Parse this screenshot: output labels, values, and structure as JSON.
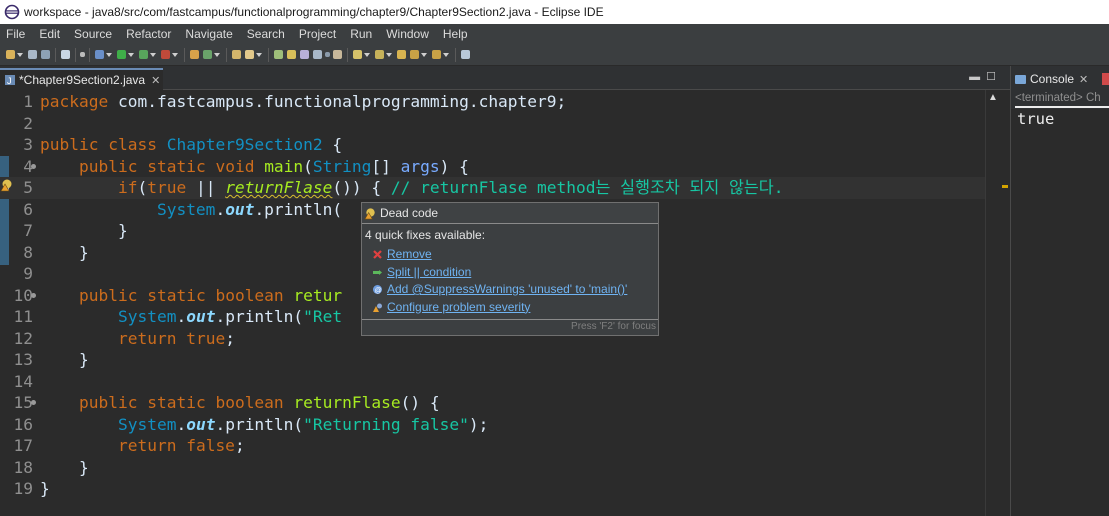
{
  "window": {
    "title": "workspace - java8/src/com/fastcampus/functionalprogramming/chapter9/Chapter9Section2.java - Eclipse IDE"
  },
  "menu": [
    "File",
    "Edit",
    "Source",
    "Refactor",
    "Navigate",
    "Search",
    "Project",
    "Run",
    "Window",
    "Help"
  ],
  "editor": {
    "tab_title": "*Chapter9Section2.java",
    "lines": [
      {
        "n": "1",
        "tokens": [
          [
            "kw",
            "package"
          ],
          [
            "plain",
            " com.fastcampus.functionalprogramming.chapter9;"
          ]
        ]
      },
      {
        "n": "2",
        "tokens": []
      },
      {
        "n": "3",
        "tokens": [
          [
            "kw",
            "public"
          ],
          [
            "plain",
            " "
          ],
          [
            "kw",
            "class"
          ],
          [
            "plain",
            " "
          ],
          [
            "typ",
            "Chapter9Section2"
          ],
          [
            "plain",
            " {"
          ]
        ]
      },
      {
        "n": "4",
        "fold": true,
        "tokens": [
          [
            "plain",
            "    "
          ],
          [
            "kw",
            "public"
          ],
          [
            "plain",
            " "
          ],
          [
            "kw",
            "static"
          ],
          [
            "plain",
            " "
          ],
          [
            "kw",
            "void"
          ],
          [
            "plain",
            " "
          ],
          [
            "mthp",
            "main"
          ],
          [
            "plain",
            "("
          ],
          [
            "typ",
            "String"
          ],
          [
            "plain",
            "[] "
          ],
          [
            "prm",
            "args"
          ],
          [
            "plain",
            ") {"
          ]
        ]
      },
      {
        "n": "5",
        "current": true,
        "tokens": [
          [
            "plain",
            "        "
          ],
          [
            "kw",
            "if"
          ],
          [
            "plain",
            "("
          ],
          [
            "kw",
            "true"
          ],
          [
            "plain",
            " || "
          ],
          [
            "mthi",
            "returnFlase"
          ],
          [
            "plain",
            "()) { "
          ],
          [
            "cmt",
            "// returnFlase method는 실행조차 되지 않는다."
          ]
        ]
      },
      {
        "n": "6",
        "tokens": [
          [
            "plain",
            "            "
          ],
          [
            "typ",
            "System"
          ],
          [
            "plain",
            "."
          ],
          [
            "fld",
            "out"
          ],
          [
            "plain",
            ".println("
          ]
        ]
      },
      {
        "n": "7",
        "tokens": [
          [
            "plain",
            "        }"
          ]
        ]
      },
      {
        "n": "8",
        "tokens": [
          [
            "plain",
            "    }"
          ]
        ]
      },
      {
        "n": "9",
        "tokens": []
      },
      {
        "n": "10",
        "fold": true,
        "tokens": [
          [
            "plain",
            "    "
          ],
          [
            "kw",
            "public"
          ],
          [
            "plain",
            " "
          ],
          [
            "kw",
            "static"
          ],
          [
            "plain",
            " "
          ],
          [
            "kw",
            "boolean"
          ],
          [
            "plain",
            " "
          ],
          [
            "mthp",
            "retur"
          ]
        ]
      },
      {
        "n": "11",
        "tokens": [
          [
            "plain",
            "        "
          ],
          [
            "typ",
            "System"
          ],
          [
            "plain",
            "."
          ],
          [
            "fld",
            "out"
          ],
          [
            "plain",
            ".println("
          ],
          [
            "str",
            "\"Ret"
          ]
        ]
      },
      {
        "n": "12",
        "tokens": [
          [
            "plain",
            "        "
          ],
          [
            "kw",
            "return"
          ],
          [
            "plain",
            " "
          ],
          [
            "kw",
            "true"
          ],
          [
            "plain",
            ";"
          ]
        ]
      },
      {
        "n": "13",
        "tokens": [
          [
            "plain",
            "    }"
          ]
        ]
      },
      {
        "n": "14",
        "tokens": []
      },
      {
        "n": "15",
        "fold": true,
        "tokens": [
          [
            "plain",
            "    "
          ],
          [
            "kw",
            "public"
          ],
          [
            "plain",
            " "
          ],
          [
            "kw",
            "static"
          ],
          [
            "plain",
            " "
          ],
          [
            "kw",
            "boolean"
          ],
          [
            "plain",
            " "
          ],
          [
            "mthp",
            "returnFlase"
          ],
          [
            "plain",
            "() {"
          ]
        ]
      },
      {
        "n": "16",
        "tokens": [
          [
            "plain",
            "        "
          ],
          [
            "typ",
            "System"
          ],
          [
            "plain",
            "."
          ],
          [
            "fld",
            "out"
          ],
          [
            "plain",
            ".println("
          ],
          [
            "str",
            "\"Returning false\""
          ],
          [
            "plain",
            ");"
          ]
        ]
      },
      {
        "n": "17",
        "tokens": [
          [
            "plain",
            "        "
          ],
          [
            "kw",
            "return"
          ],
          [
            "plain",
            " "
          ],
          [
            "kw",
            "false"
          ],
          [
            "plain",
            ";"
          ]
        ]
      },
      {
        "n": "18",
        "tokens": [
          [
            "plain",
            "    }"
          ]
        ]
      },
      {
        "n": "19",
        "tokens": [
          [
            "plain",
            "}"
          ]
        ]
      }
    ]
  },
  "quickfix": {
    "title": "Dead code",
    "header": "4 quick fixes available:",
    "fixes": [
      {
        "label": "Remove",
        "icon": "remove-icon"
      },
      {
        "label": "Split || condition",
        "icon": "split-icon"
      },
      {
        "label": "Add @SuppressWarnings 'unused' to 'main()'",
        "icon": "annotation-icon"
      },
      {
        "label": "Configure problem severity",
        "icon": "configure-icon"
      }
    ],
    "footer": "Press 'F2' for focus"
  },
  "console": {
    "tab_title": "Console",
    "status": "<terminated> Ch",
    "output": "true"
  }
}
